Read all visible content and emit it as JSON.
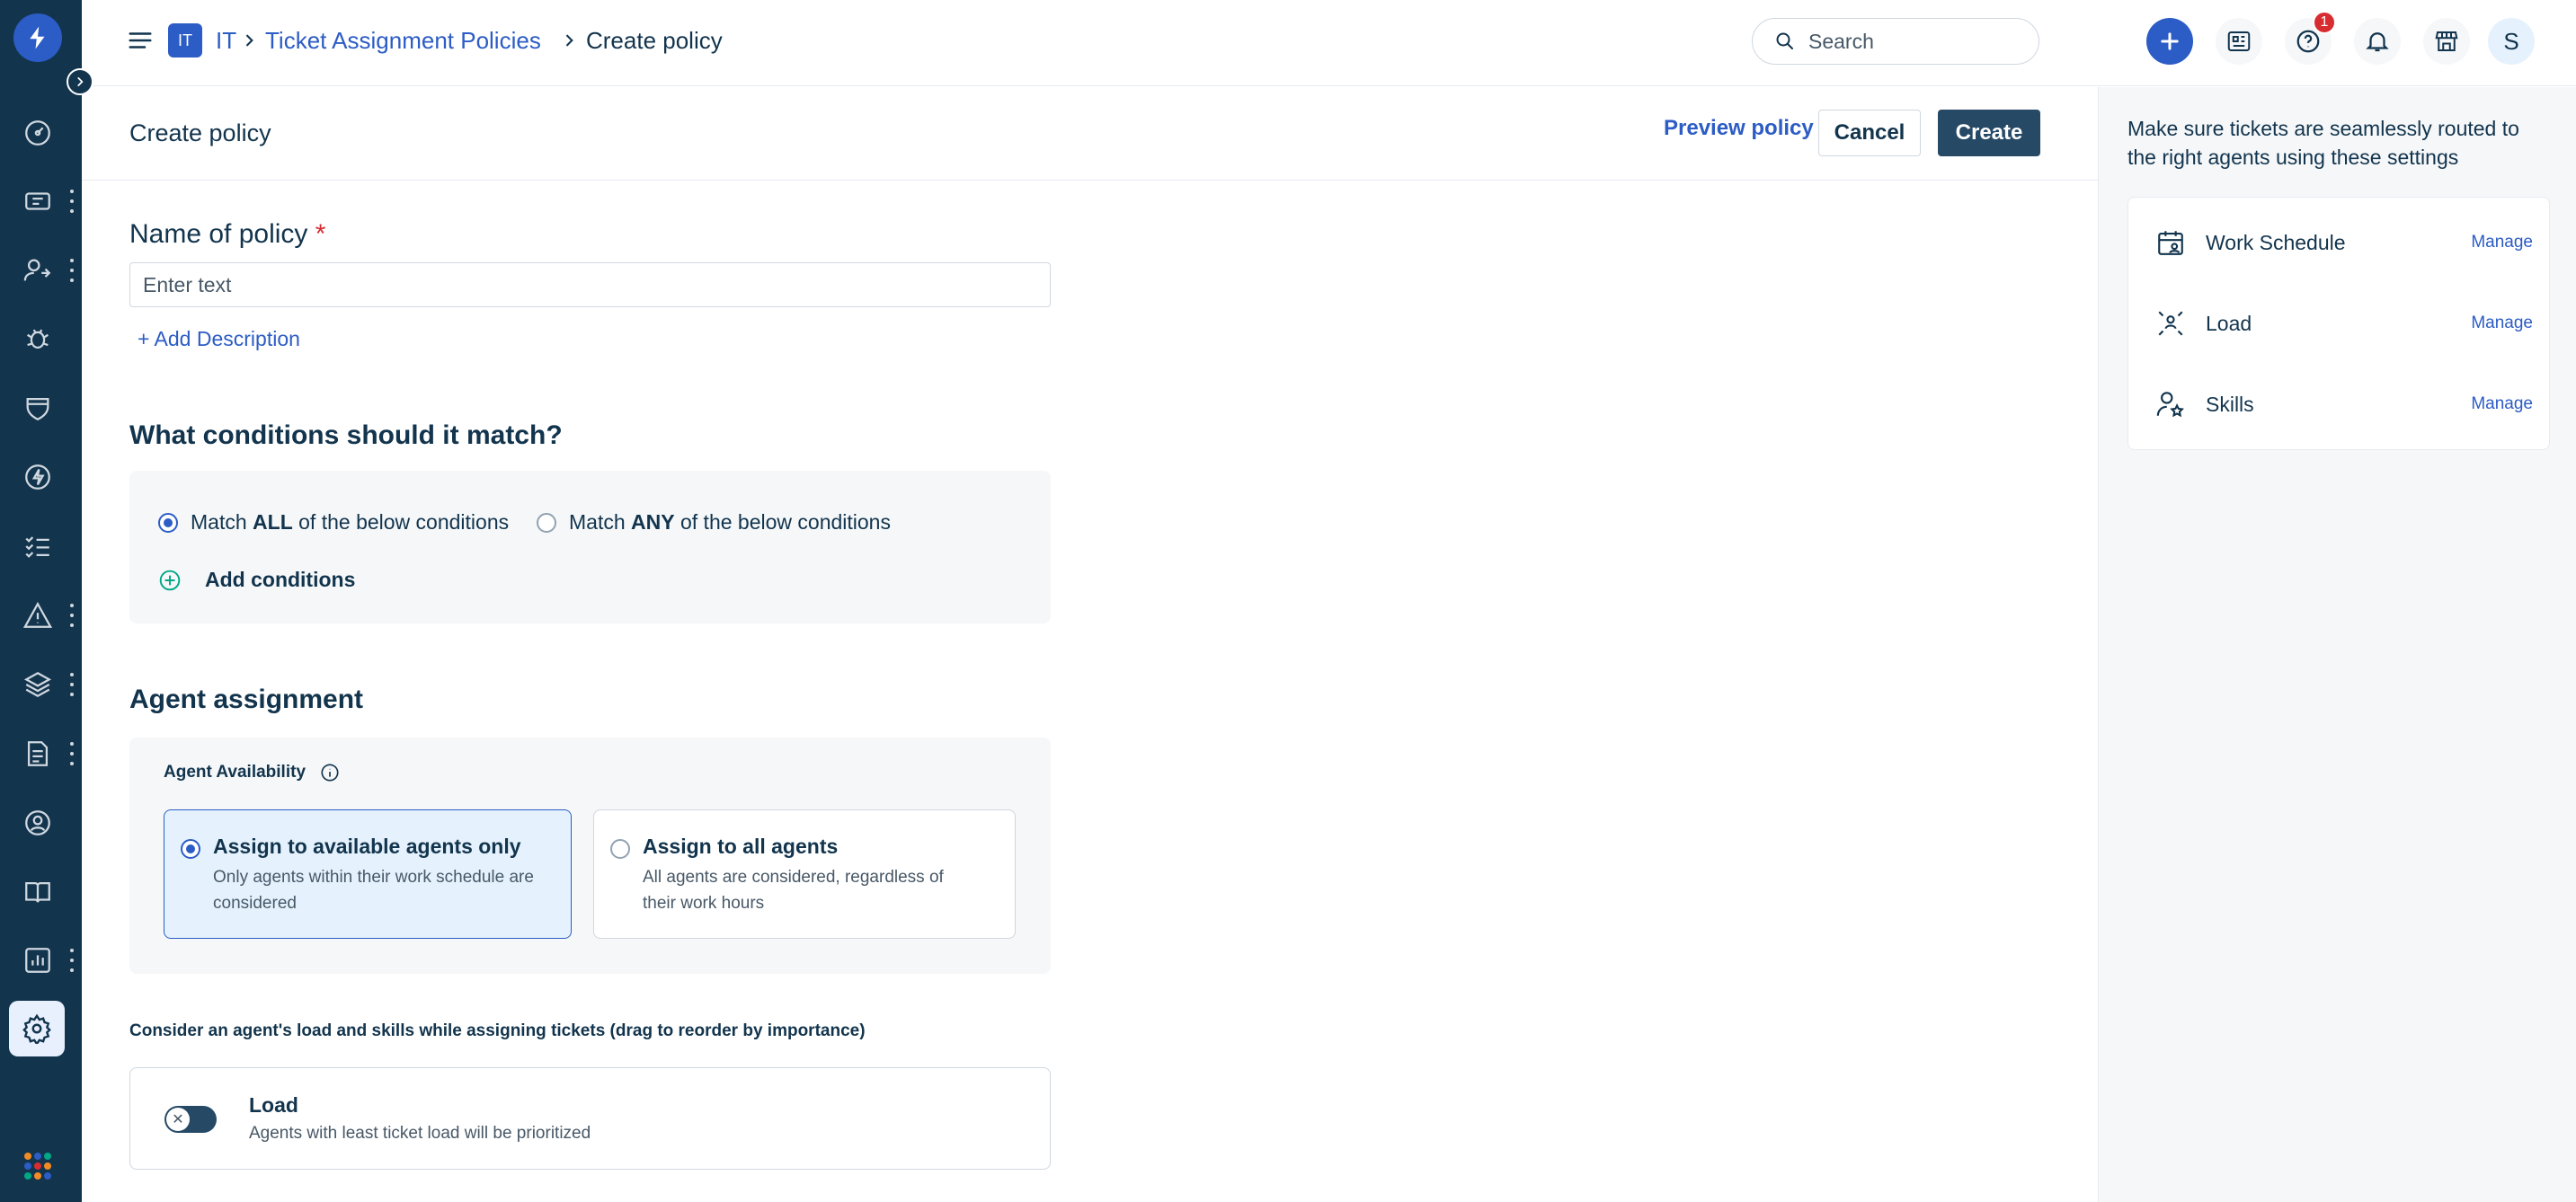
{
  "rail": {
    "items": [
      {
        "icon": "dashboard-icon"
      },
      {
        "icon": "tickets-icon"
      },
      {
        "icon": "agents-icon"
      },
      {
        "icon": "bug-icon"
      },
      {
        "icon": "shield-icon"
      },
      {
        "icon": "bolt-icon"
      },
      {
        "icon": "tasks-icon"
      },
      {
        "icon": "alert-icon"
      },
      {
        "icon": "layers-icon"
      },
      {
        "icon": "contract-icon"
      },
      {
        "icon": "support-icon"
      },
      {
        "icon": "book-icon"
      },
      {
        "icon": "reports-icon"
      },
      {
        "icon": "settings-icon"
      }
    ]
  },
  "header": {
    "workspace_badge": "IT",
    "breadcrumb": [
      "IT",
      "Ticket Assignment Policies",
      "Create policy"
    ],
    "search_placeholder": "Search",
    "notification_count": "1",
    "avatar_initial": "S"
  },
  "page": {
    "title": "Create policy",
    "preview_label": "Preview policy",
    "cancel_label": "Cancel",
    "create_label": "Create"
  },
  "form": {
    "name_label": "Name of policy",
    "required_mark": "*",
    "name_placeholder": "Enter text",
    "name_value": "",
    "add_description": "+ Add Description",
    "conditions_title": "What conditions should it match?",
    "match_all_pre": "Match ",
    "match_all_bold": "ALL",
    "match_all_post": " of the below conditions",
    "match_any_pre": "Match ",
    "match_any_bold": "ANY",
    "match_any_post": " of the below conditions",
    "add_conditions": "Add conditions",
    "agent_assignment_title": "Agent assignment",
    "agent_availability_label": "Agent Availability",
    "option_available_title": "Assign to available agents only",
    "option_available_desc": "Only agents within their work schedule are considered",
    "option_all_title": "Assign to all agents",
    "option_all_desc": "All agents are considered, regardless of their work hours",
    "consider_text": "Consider an agent's load and skills while assigning tickets (drag to reorder by importance)",
    "load_title": "Load",
    "load_desc": "Agents with least ticket load will be prioritized"
  },
  "right_panel": {
    "intro": "Make sure tickets are seamlessly routed to the right agents using these settings",
    "items": [
      {
        "label": "Work Schedule",
        "action": "Manage",
        "icon": "calendar-user-icon"
      },
      {
        "label": "Load",
        "action": "Manage",
        "icon": "load-icon"
      },
      {
        "label": "Skills",
        "action": "Manage",
        "icon": "user-star-icon"
      }
    ]
  },
  "colors": {
    "rail_bg": "#12344d",
    "accent": "#2c5cc5",
    "primary_button": "#264966",
    "required": "#d72d30"
  }
}
